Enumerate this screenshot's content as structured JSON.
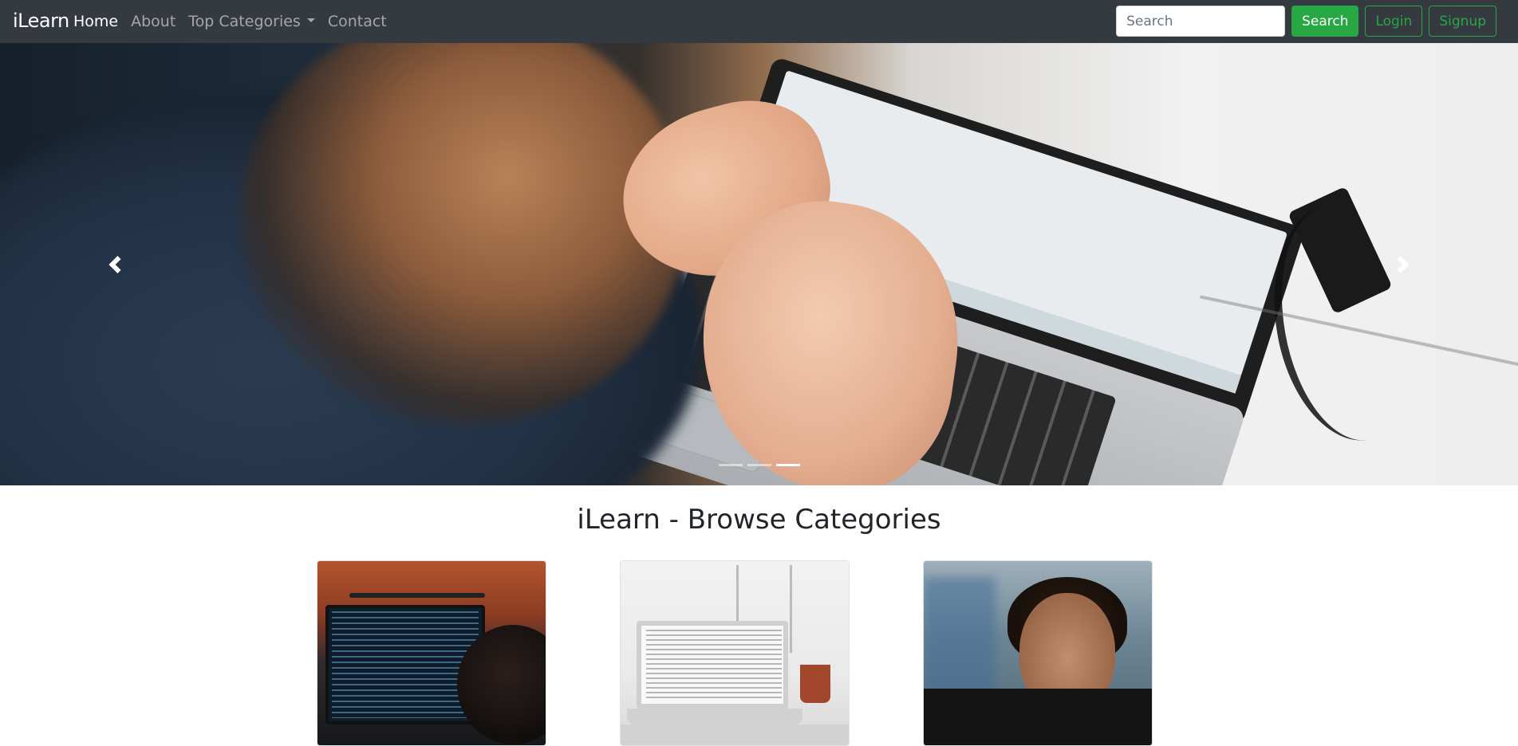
{
  "nav": {
    "brand": "iLearn",
    "links": [
      {
        "label": "Home",
        "active": true
      },
      {
        "label": "About",
        "active": false
      },
      {
        "label": "Top Categories",
        "active": false,
        "dropdown": true
      },
      {
        "label": "Contact",
        "active": false
      }
    ],
    "search_placeholder": "Search",
    "search_button": "Search",
    "login_button": "Login",
    "signup_button": "Signup"
  },
  "carousel": {
    "slide_count": 3,
    "active_slide": 3
  },
  "main": {
    "heading": "iLearn - Browse Categories"
  },
  "colors": {
    "navbar_bg": "#343a40",
    "accent_green": "#28a745",
    "text_dark": "#212529"
  }
}
